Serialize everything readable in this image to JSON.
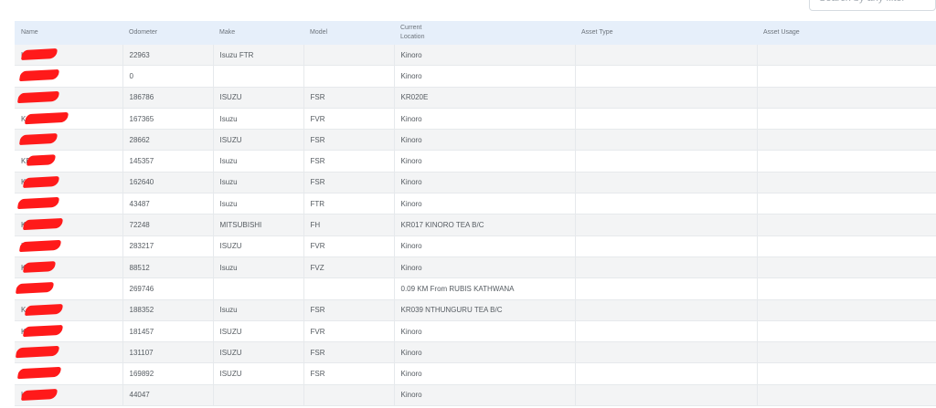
{
  "search": {
    "placeholder": "Search by any filter"
  },
  "columns": [
    "Name",
    "Odometer",
    "Make",
    "Model",
    "Current\nLocation",
    "Asset Type",
    "Asset Usage"
  ],
  "rows": [
    {
      "name": "K",
      "odometer": "22963",
      "make": "Isuzu FTR",
      "model": "",
      "location": "Kinoro",
      "asset_type": "",
      "asset_usage": ""
    },
    {
      "name": "P",
      "odometer": "0",
      "make": "",
      "model": "",
      "location": "Kinoro",
      "asset_type": "",
      "asset_usage": ""
    },
    {
      "name": "",
      "odometer": "186786",
      "make": "ISUZU",
      "model": "FSR",
      "location": "KR020E",
      "asset_type": "",
      "asset_usage": ""
    },
    {
      "name": "K",
      "odometer": "167365",
      "make": "Isuzu",
      "model": "FVR",
      "location": "Kinoro",
      "asset_type": "",
      "asset_usage": ""
    },
    {
      "name": "K",
      "odometer": "28662",
      "make": "ISUZU",
      "model": "FSR",
      "location": "Kinoro",
      "asset_type": "",
      "asset_usage": ""
    },
    {
      "name": "KB",
      "odometer": "145357",
      "make": "Isuzu",
      "model": "FSR",
      "location": "Kinoro",
      "asset_type": "",
      "asset_usage": ""
    },
    {
      "name": "K",
      "odometer": "162640",
      "make": "Isuzu",
      "model": "FSR",
      "location": "Kinoro",
      "asset_type": "",
      "asset_usage": ""
    },
    {
      "name": "K",
      "odometer": "43487",
      "make": "Isuzu",
      "model": "FTR",
      "location": "Kinoro",
      "asset_type": "",
      "asset_usage": ""
    },
    {
      "name": "K",
      "odometer": "72248",
      "make": "MITSUBISHI",
      "model": "FH",
      "location": "KR017 KINORO TEA B/C",
      "asset_type": "",
      "asset_usage": ""
    },
    {
      "name": "K",
      "odometer": "283217",
      "make": "ISUZU",
      "model": "FVR",
      "location": "Kinoro",
      "asset_type": "",
      "asset_usage": ""
    },
    {
      "name": "K",
      "odometer": "88512",
      "make": "Isuzu",
      "model": "FVZ",
      "location": "Kinoro",
      "asset_type": "",
      "asset_usage": ""
    },
    {
      "name": "",
      "odometer": "269746",
      "make": "",
      "model": "",
      "location": "0.09 KM From RUBIS KATHWANA",
      "asset_type": "",
      "asset_usage": ""
    },
    {
      "name": "K",
      "odometer": "188352",
      "make": "Isuzu",
      "model": "FSR",
      "location": "KR039 NTHUNGURU TEA B/C",
      "asset_type": "",
      "asset_usage": ""
    },
    {
      "name": "K",
      "odometer": "181457",
      "make": "ISUZU",
      "model": "FVR",
      "location": "Kinoro",
      "asset_type": "",
      "asset_usage": ""
    },
    {
      "name": "",
      "odometer": "131107",
      "make": "ISUZU",
      "model": "FSR",
      "location": "Kinoro",
      "asset_type": "",
      "asset_usage": ""
    },
    {
      "name": "",
      "odometer": "169892",
      "make": "ISUZU",
      "model": "FSR",
      "location": "Kinoro",
      "asset_type": "",
      "asset_usage": ""
    },
    {
      "name": "K",
      "odometer": "44047",
      "make": "",
      "model": "",
      "location": "Kinoro",
      "asset_type": "",
      "asset_usage": ""
    }
  ],
  "colors": {
    "header_bg": "#e6effa",
    "row_alt_bg": "#f3f4f5",
    "redaction": "#ff1a1a"
  }
}
